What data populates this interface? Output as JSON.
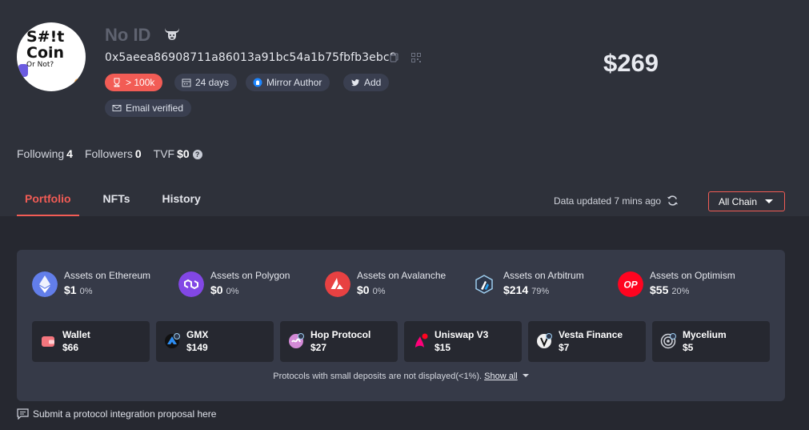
{
  "profile": {
    "name": "No ID",
    "avatar_text": [
      "S#!t",
      "Coin",
      "Or Not?"
    ],
    "address": "0x5aeea86908711a86013a91bc54a1b75fbfb3ebc8",
    "net_worth": "$269",
    "badges": [
      {
        "label": "> 100k",
        "icon": "trophy-icon"
      },
      {
        "label": "24 days",
        "icon": "calendar-icon"
      },
      {
        "label": "Mirror Author",
        "icon": "mirror-icon"
      },
      {
        "label": "Add",
        "icon": "twitter-icon"
      },
      {
        "label": "Email verified",
        "icon": "mail-icon"
      }
    ]
  },
  "stats": {
    "following_label": "Following",
    "following": "4",
    "followers_label": "Followers",
    "followers": "0",
    "tvf_label": "TVF",
    "tvf": "$0"
  },
  "tabs": [
    "Portfolio",
    "NFTs",
    "History"
  ],
  "active_tab": "Portfolio",
  "updated": "Data updated 7 mins ago",
  "chain_filter": "All Chain",
  "chains": [
    {
      "label": "Assets on Ethereum",
      "value": "$1",
      "pct": "0%",
      "color": "#627eea"
    },
    {
      "label": "Assets on Polygon",
      "value": "$0",
      "pct": "0%",
      "color": "#8247e5"
    },
    {
      "label": "Assets on Avalanche",
      "value": "$0",
      "pct": "0%",
      "color": "#e84142"
    },
    {
      "label": "Assets on Arbitrum",
      "value": "$214",
      "pct": "79%",
      "color": "#2d374b"
    },
    {
      "label": "Assets on Optimism",
      "value": "$55",
      "pct": "20%",
      "color": "#ff0420"
    }
  ],
  "protocols": [
    {
      "name": "Wallet",
      "value": "$66"
    },
    {
      "name": "GMX",
      "value": "$149"
    },
    {
      "name": "Hop Protocol",
      "value": "$27"
    },
    {
      "name": "Uniswap V3",
      "value": "$15"
    },
    {
      "name": "Vesta Finance",
      "value": "$7"
    },
    {
      "name": "Mycelium",
      "value": "$5"
    }
  ],
  "note": "Protocols with small deposits are not displayed(<1%).",
  "show_all": "Show all",
  "submit_link": "Submit a protocol integration proposal here"
}
